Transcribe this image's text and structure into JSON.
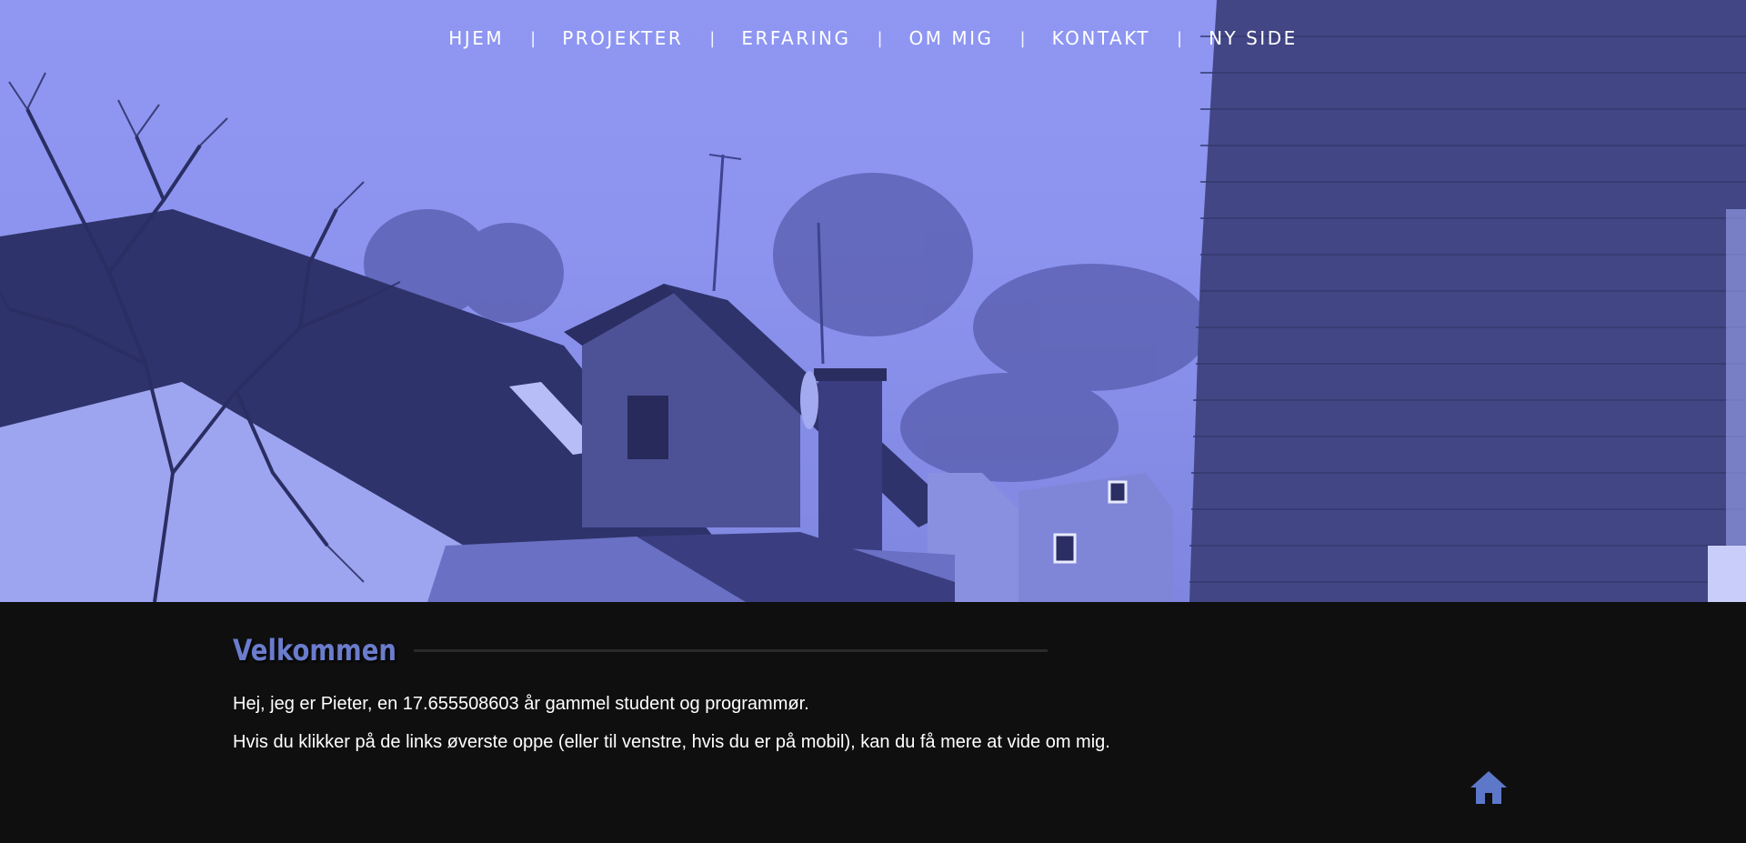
{
  "nav": {
    "items": [
      {
        "label": "HJEM"
      },
      {
        "label": "PROJEKTER"
      },
      {
        "label": "ERFARING"
      },
      {
        "label": "OM MIG"
      },
      {
        "label": "KONTAKT"
      },
      {
        "label": "NY SIDE"
      }
    ],
    "separator": "|"
  },
  "welcome": {
    "title": "Velkommen",
    "paragraph1": "Hej, jeg er Pieter, en 17.655508603 år gammel student og programmør.",
    "paragraph2": "Hvis du klikker på de links øverste oppe (eller til venstre, hvis du er på mobil), kan du få mere at vide om mig."
  },
  "icons": {
    "home_button": "home-icon"
  },
  "colors": {
    "hero_tint": "#8f97f3",
    "background": "#0f0f0f",
    "heading": "#6b7ccd",
    "text": "#ffffff",
    "home_icon": "#5d78c9"
  }
}
